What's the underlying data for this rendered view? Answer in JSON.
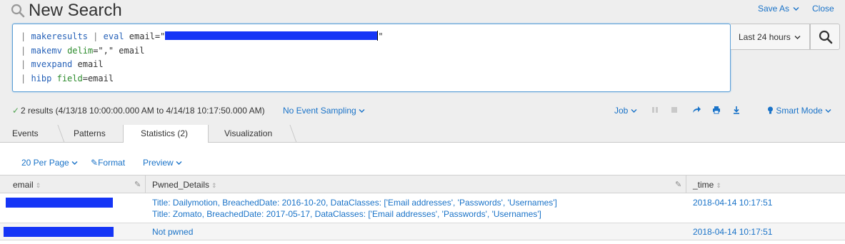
{
  "header": {
    "title": "New Search",
    "save_as": "Save As",
    "close": "Close",
    "search_icon": "magnifier-icon"
  },
  "search": {
    "lines": [
      {
        "pipe": "|",
        "cmd": "makeresults",
        "mid": " | ",
        "cmd2": "eval",
        "rest": " email=\"",
        "tail": "\""
      },
      {
        "pipe": "|",
        "cmd": "makemv",
        "arg": "delim",
        "rest": "=\",\" email"
      },
      {
        "pipe": "|",
        "cmd": "mvexpand",
        "rest": " email"
      },
      {
        "pipe": "|",
        "cmd": "hibp",
        "arg": "field",
        "rest": "=email"
      }
    ],
    "time_range": "Last 24 hours",
    "submit_icon": "search-icon"
  },
  "status": {
    "results": "2 results (4/13/18 10:00:00.000 AM to 4/14/18 10:17:50.000 AM)",
    "sampling": "No Event Sampling",
    "job": "Job",
    "smart_mode": "Smart Mode"
  },
  "tabs": [
    {
      "label": "Events"
    },
    {
      "label": "Patterns"
    },
    {
      "label": "Statistics (2)",
      "active": true
    },
    {
      "label": "Visualization"
    }
  ],
  "controls": {
    "per_page": "20 Per Page",
    "format": "Format",
    "preview": "Preview"
  },
  "table": {
    "columns": [
      "email",
      "Pwned_Details",
      "_time"
    ],
    "rows": [
      {
        "email": "",
        "details": [
          "Title: Dailymotion, BreachedDate: 2016-10-20, DataClasses: ['Email addresses', 'Passwords', 'Usernames']",
          "Title: Zomato, BreachedDate: 2017-05-17, DataClasses: ['Email addresses', 'Passwords', 'Usernames']"
        ],
        "time": "2018-04-14 10:17:51"
      },
      {
        "email": "",
        "details": [
          "Not pwned"
        ],
        "time": "2018-04-14 10:17:51"
      }
    ]
  },
  "colors": {
    "link": "#1a73c8",
    "redaction": "#1535f6",
    "success": "#4fa34f"
  }
}
